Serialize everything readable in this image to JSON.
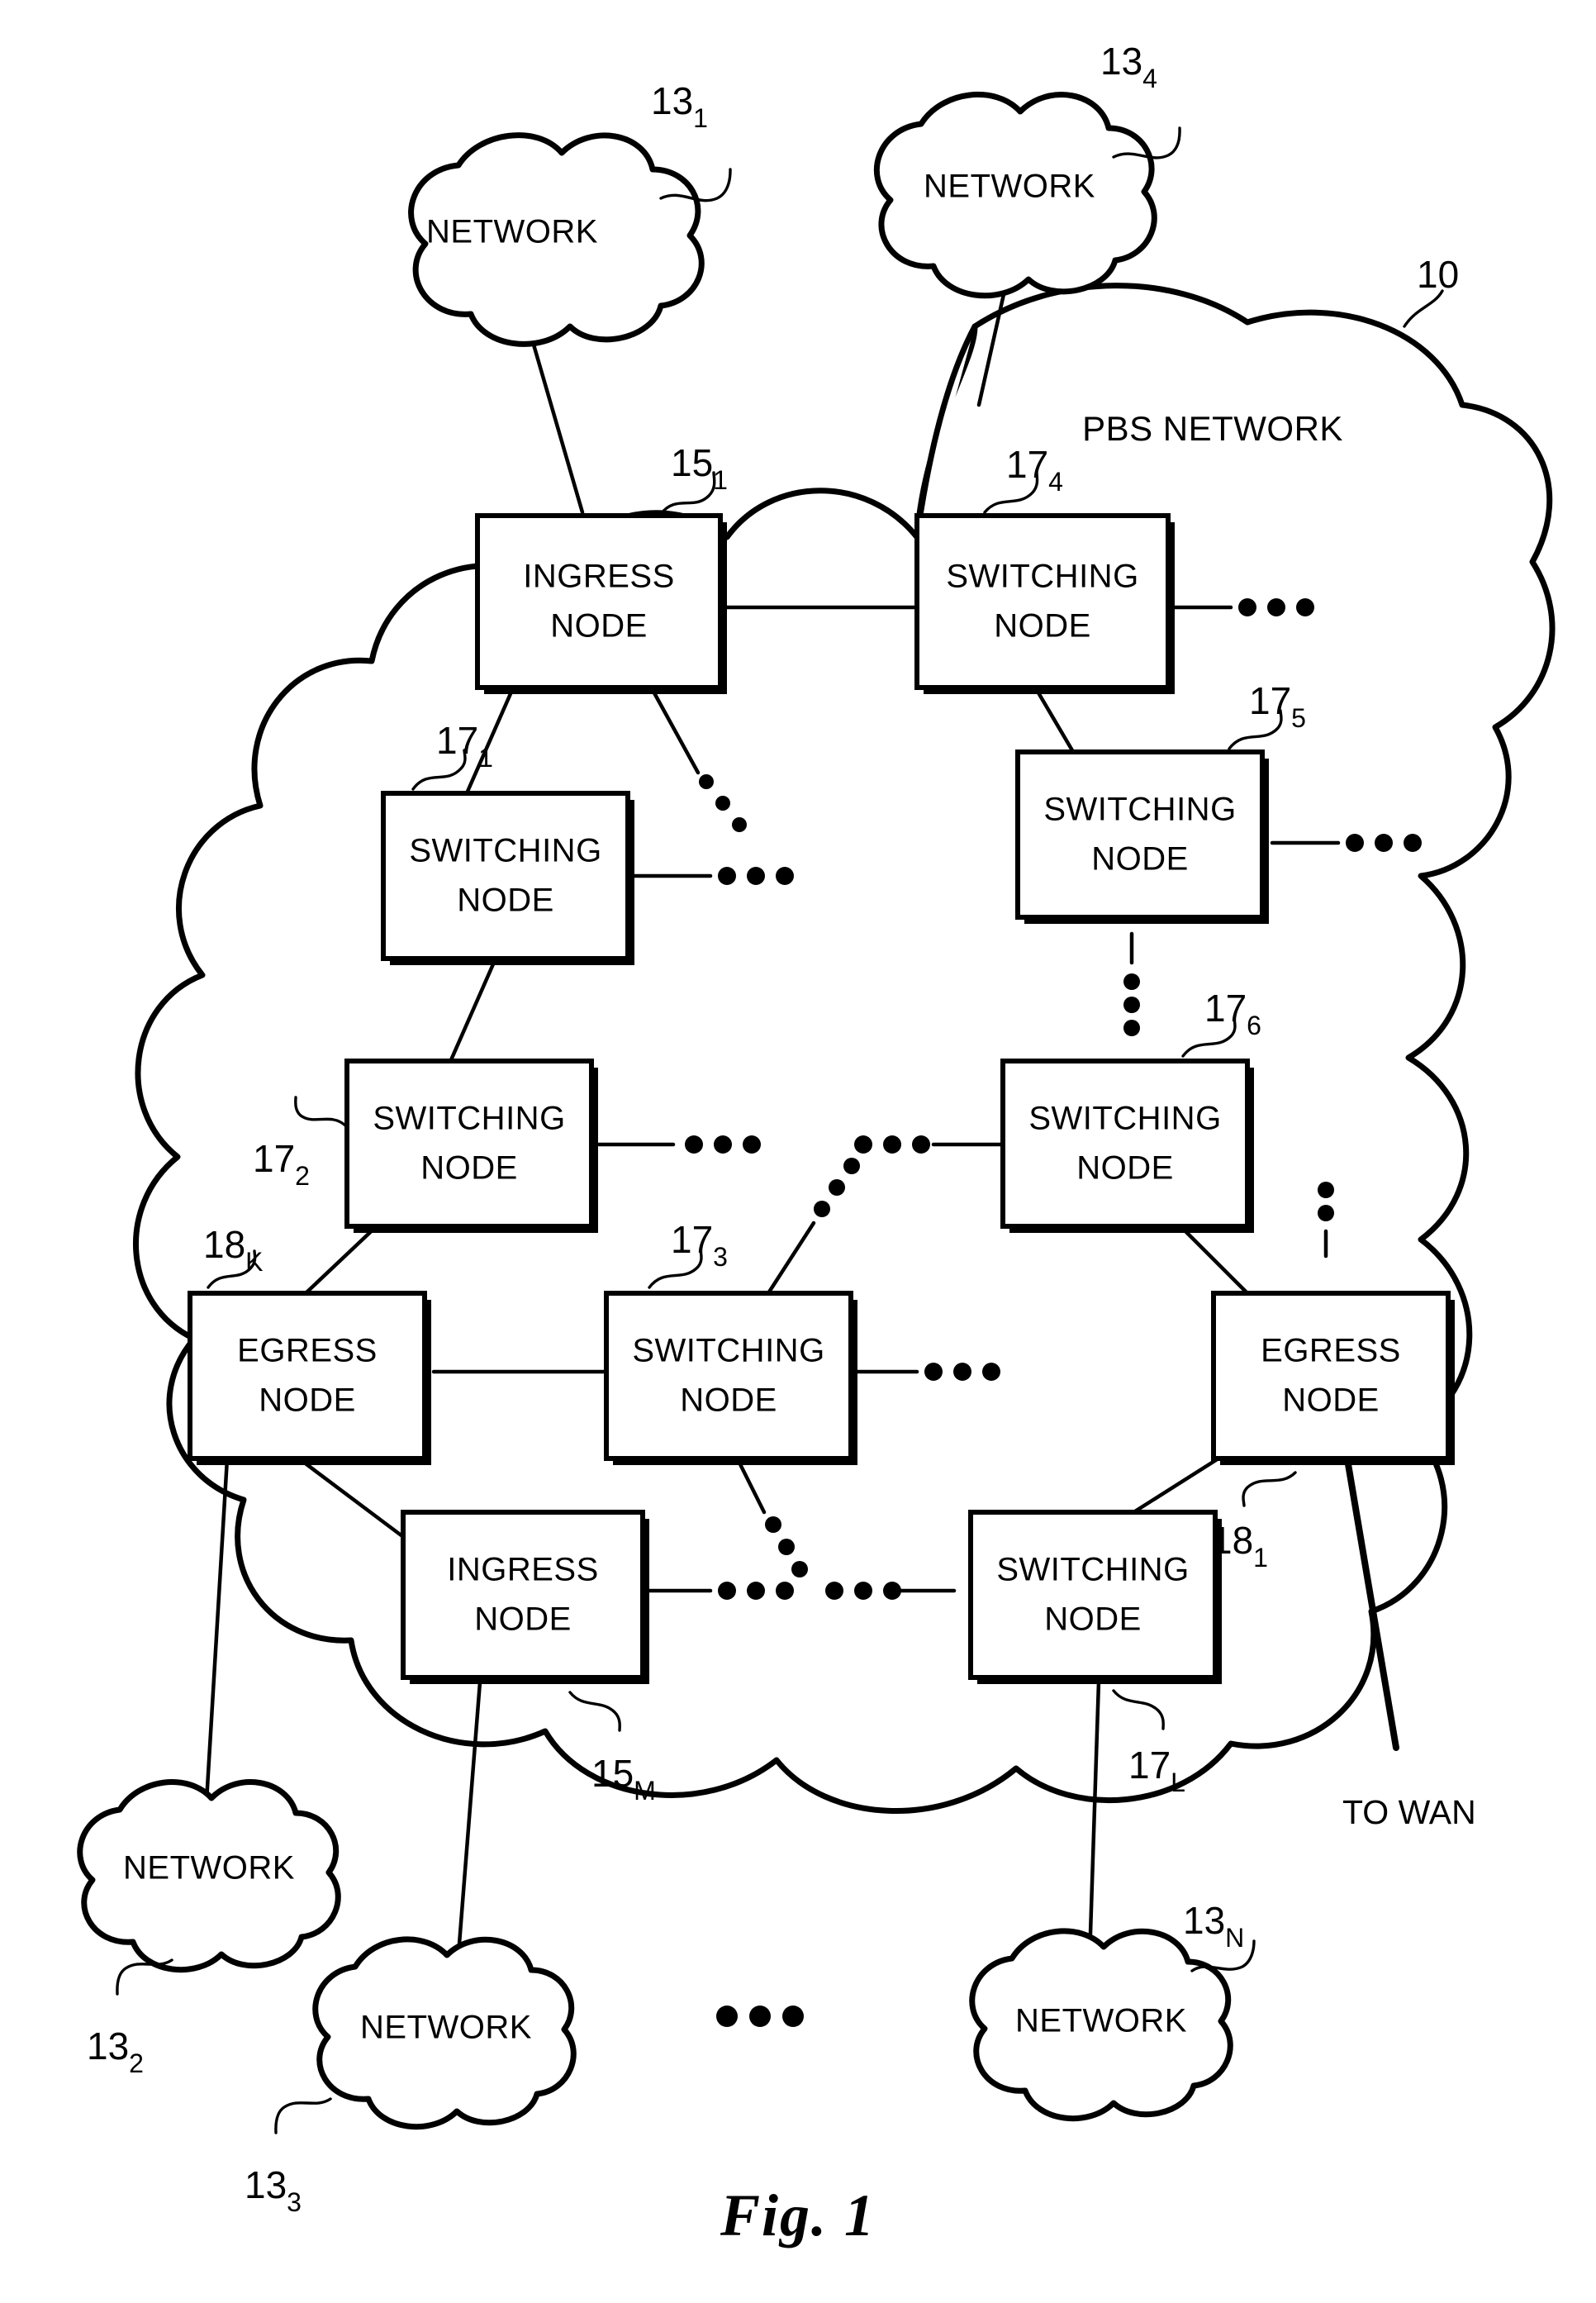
{
  "figure": {
    "caption": "Fig. 1",
    "pbs_network_label": "PBS NETWORK",
    "pbs_network_ref": "10",
    "to_wan_label": "TO WAN"
  },
  "clouds": [
    {
      "id": "network-1",
      "label": "NETWORK",
      "ref_base": "13",
      "ref_sub": "1"
    },
    {
      "id": "network-4",
      "label": "NETWORK",
      "ref_base": "13",
      "ref_sub": "4"
    },
    {
      "id": "network-2",
      "label": "NETWORK",
      "ref_base": "13",
      "ref_sub": "2"
    },
    {
      "id": "network-3",
      "label": "NETWORK",
      "ref_base": "13",
      "ref_sub": "3"
    },
    {
      "id": "network-n",
      "label": "NETWORK",
      "ref_base": "13",
      "ref_sub": "N"
    }
  ],
  "nodes": [
    {
      "id": "ingress-1",
      "line1": "INGRESS",
      "line2": "NODE",
      "ref_base": "15",
      "ref_sub": "1"
    },
    {
      "id": "switching-4",
      "line1": "SWITCHING",
      "line2": "NODE",
      "ref_base": "17",
      "ref_sub": "4"
    },
    {
      "id": "switching-1",
      "line1": "SWITCHING",
      "line2": "NODE",
      "ref_base": "17",
      "ref_sub": "1"
    },
    {
      "id": "switching-5",
      "line1": "SWITCHING",
      "line2": "NODE",
      "ref_base": "17",
      "ref_sub": "5"
    },
    {
      "id": "switching-2",
      "line1": "SWITCHING",
      "line2": "NODE",
      "ref_base": "17",
      "ref_sub": "2"
    },
    {
      "id": "switching-6",
      "line1": "SWITCHING",
      "line2": "NODE",
      "ref_base": "17",
      "ref_sub": "6"
    },
    {
      "id": "egress-k",
      "line1": "EGRESS",
      "line2": "NODE",
      "ref_base": "18",
      "ref_sub": "K"
    },
    {
      "id": "switching-3",
      "line1": "SWITCHING",
      "line2": "NODE",
      "ref_base": "17",
      "ref_sub": "3"
    },
    {
      "id": "egress-1",
      "line1": "EGRESS",
      "line2": "NODE",
      "ref_base": "18",
      "ref_sub": "1"
    },
    {
      "id": "ingress-m",
      "line1": "INGRESS",
      "line2": "NODE",
      "ref_base": "15",
      "ref_sub": "M"
    },
    {
      "id": "switching-l",
      "line1": "SWITCHING",
      "line2": "NODE",
      "ref_base": "17",
      "ref_sub": "L"
    }
  ],
  "colors": {
    "ink": "#000000",
    "paper": "#ffffff"
  }
}
